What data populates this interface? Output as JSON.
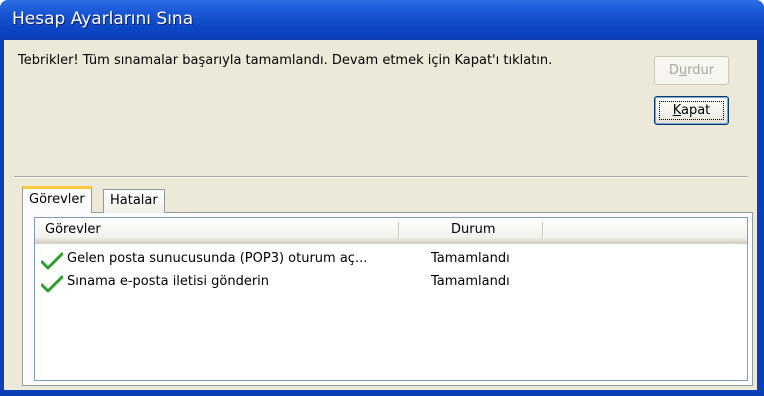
{
  "window": {
    "title": "Hesap Ayarlarını Sına",
    "colors": {
      "titlebar": "#0d46c5",
      "client": "#ece9d8",
      "tab_highlight": "#ffc83c",
      "check": "#2e9e2e"
    }
  },
  "message": "Tebrikler! Tüm sınamalar başarıyla tamamlandı. Devam etmek için Kapat'ı tıklatın.",
  "buttons": {
    "stop": {
      "pre": "D",
      "accel": "u",
      "post": "rdur",
      "enabled": false
    },
    "close": {
      "pre": "",
      "accel": "K",
      "post": "apat",
      "enabled": true
    }
  },
  "tabs": [
    {
      "label": "Görevler",
      "active": true
    },
    {
      "label": "Hatalar",
      "active": false
    }
  ],
  "table": {
    "columns": [
      "Görevler",
      "Durum"
    ],
    "rows": [
      {
        "icon": "checkmark-icon",
        "task": "Gelen posta sunucusunda (POP3) oturum aç...",
        "status": "Tamamlandı"
      },
      {
        "icon": "checkmark-icon",
        "task": "Sınama e-posta iletisi gönderin",
        "status": "Tamamlandı"
      }
    ]
  }
}
